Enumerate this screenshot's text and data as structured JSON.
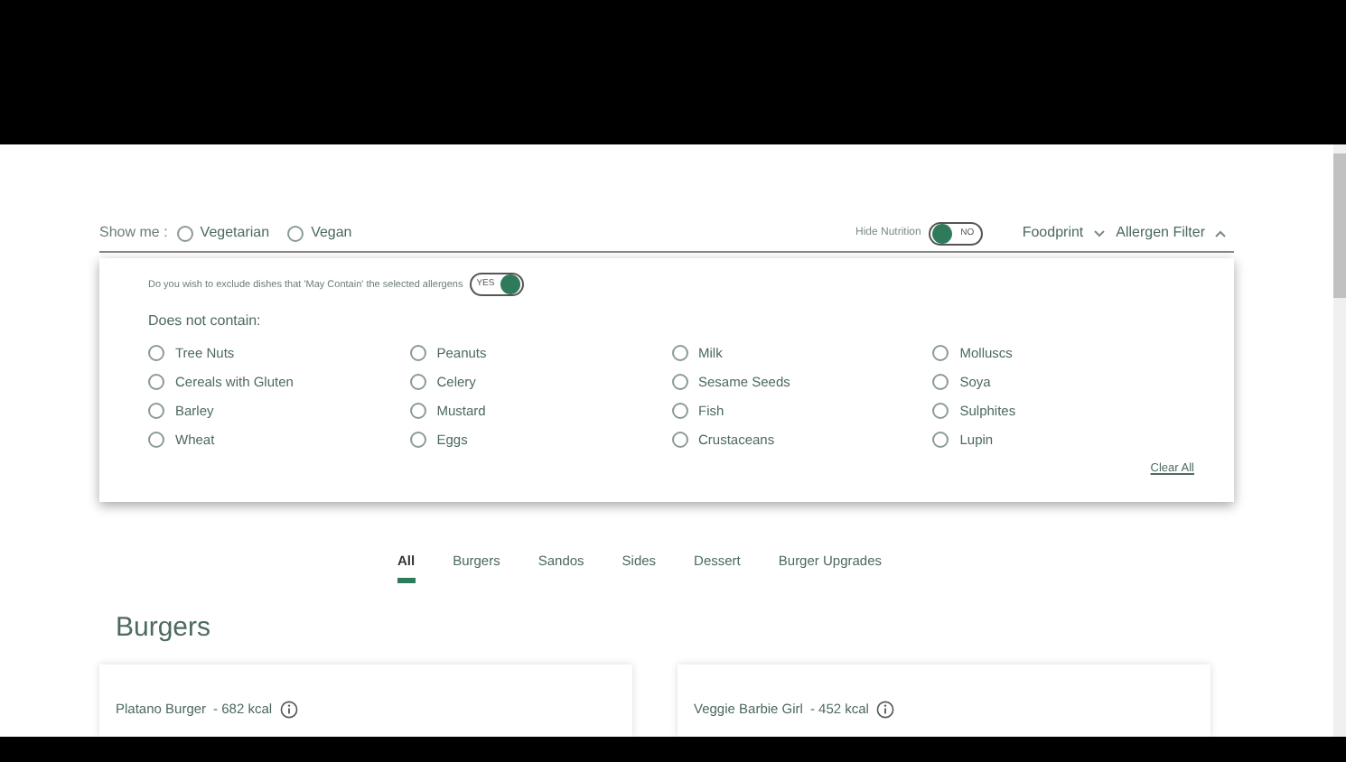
{
  "filter_bar": {
    "show_me_label": "Show me :",
    "diet_options": [
      {
        "label": "Vegetarian",
        "selected": false
      },
      {
        "label": "Vegan",
        "selected": false
      }
    ],
    "hide_nutrition": {
      "label": "Hide Nutrition",
      "on": false,
      "state_text": "NO"
    },
    "dropdowns": [
      {
        "label": "Foodprint",
        "expanded": false
      },
      {
        "label": "Allergen Filter",
        "expanded": true
      }
    ]
  },
  "allergen_panel": {
    "may_contain": {
      "question": "Do you wish to exclude dishes that 'May Contain' the selected allergens",
      "on": true,
      "state_text": "YES"
    },
    "heading": "Does not contain:",
    "allergens": [
      {
        "label": "Tree Nuts",
        "checked": false
      },
      {
        "label": "Peanuts",
        "checked": false
      },
      {
        "label": "Milk",
        "checked": false
      },
      {
        "label": "Molluscs",
        "checked": false
      },
      {
        "label": "Cereals with Gluten",
        "checked": false
      },
      {
        "label": "Celery",
        "checked": false
      },
      {
        "label": "Sesame Seeds",
        "checked": false
      },
      {
        "label": "Soya",
        "checked": false
      },
      {
        "label": "Barley",
        "checked": false
      },
      {
        "label": "Mustard",
        "checked": false
      },
      {
        "label": "Fish",
        "checked": false
      },
      {
        "label": "Sulphites",
        "checked": false
      },
      {
        "label": "Wheat",
        "checked": false
      },
      {
        "label": "Eggs",
        "checked": false
      },
      {
        "label": "Crustaceans",
        "checked": false
      },
      {
        "label": "Lupin",
        "checked": false
      }
    ],
    "clear_all": "Clear All"
  },
  "category_tabs": [
    {
      "label": "All",
      "selected": true
    },
    {
      "label": "Burgers",
      "selected": false
    },
    {
      "label": "Sandos",
      "selected": false
    },
    {
      "label": "Sides",
      "selected": false
    },
    {
      "label": "Dessert",
      "selected": false
    },
    {
      "label": "Burger Upgrades",
      "selected": false
    }
  ],
  "section_title": "Burgers",
  "dishes": [
    {
      "name": "Platano Burger",
      "kcal": "- 682 kcal"
    },
    {
      "name": "Veggie Barbie Girl",
      "kcal": "- 452 kcal"
    }
  ]
}
